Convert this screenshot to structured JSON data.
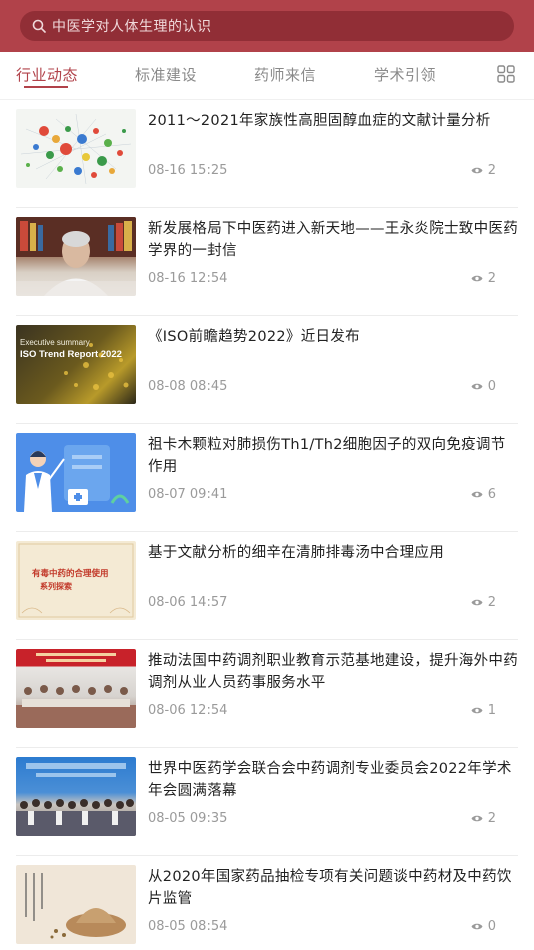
{
  "search": {
    "placeholder": "中医学对人体生理的认识"
  },
  "tabs": [
    {
      "label": "行业动态",
      "active": true
    },
    {
      "label": "标准建设",
      "active": false
    },
    {
      "label": "药师来信",
      "active": false
    },
    {
      "label": "学术引领",
      "active": false
    }
  ],
  "articles": [
    {
      "title": "2011～2021年家族性高胆固醇血症的文献计量分析",
      "date": "08-16 15:25",
      "views": "2"
    },
    {
      "title": "新发展格局下中医药进入新天地——王永炎院士致中医药学界的一封信",
      "date": "08-16 12:54",
      "views": "2"
    },
    {
      "title": "《ISO前瞻趋势2022》近日发布",
      "date": "08-08 08:45",
      "views": "0",
      "thumb_text_1": "Executive summary",
      "thumb_text_2": "ISO Trend Report 2022"
    },
    {
      "title": "祖卡木颗粒对肺损伤Th1/Th2细胞因子的双向免疫调节作用",
      "date": "08-07 09:41",
      "views": "6"
    },
    {
      "title": "基于文献分析的细辛在清肺排毒汤中合理应用",
      "date": "08-06 14:57",
      "views": "2",
      "thumb_text_1": "有毒中药的合理使用",
      "thumb_text_2": "系列探索"
    },
    {
      "title": "推动法国中药调剂职业教育示范基地建设，提升海外中药调剂从业人员药事服务水平",
      "date": "08-06 12:54",
      "views": "1"
    },
    {
      "title": "世界中医药学会联合会中药调剂专业委员会2022年学术年会圆满落幕",
      "date": "08-05 09:35",
      "views": "2"
    },
    {
      "title": "从2020年国家药品抽检专项有关问题谈中药材及中药饮片监管",
      "date": "08-05 08:54",
      "views": "0"
    }
  ],
  "colors": {
    "brand": "#b1424a",
    "brand_dark": "#912e36",
    "text": "#222222",
    "muted": "#9a9a9a"
  }
}
